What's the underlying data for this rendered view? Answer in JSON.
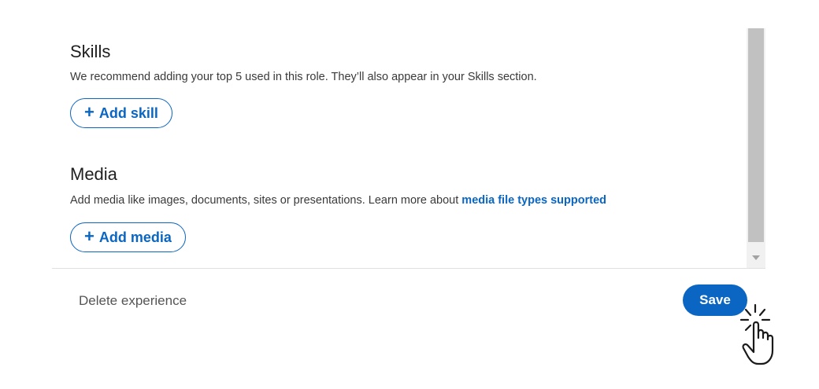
{
  "skills": {
    "title": "Skills",
    "description": "We recommend adding your top 5 used in this role. They’ll also appear in your Skills section.",
    "add_button_icon": "+",
    "add_button_label": "Add skill"
  },
  "media": {
    "title": "Media",
    "description_prefix": "Add media like images, documents, sites or presentations. Learn more about ",
    "description_link": "media file types supported",
    "add_button_icon": "+",
    "add_button_label": "Add media"
  },
  "footer": {
    "delete_label": "Delete experience",
    "save_label": "Save"
  },
  "icons": {
    "plus": "plus-icon",
    "cursor": "hand-pointer-click-icon",
    "scroll_down": "scroll-down-arrow-icon"
  },
  "colors": {
    "accent": "#0a66c2",
    "title_text": "#1f1f1f",
    "body_text": "#3a3a3a",
    "secondary_text": "#555555",
    "divider": "#e0e0e0"
  }
}
